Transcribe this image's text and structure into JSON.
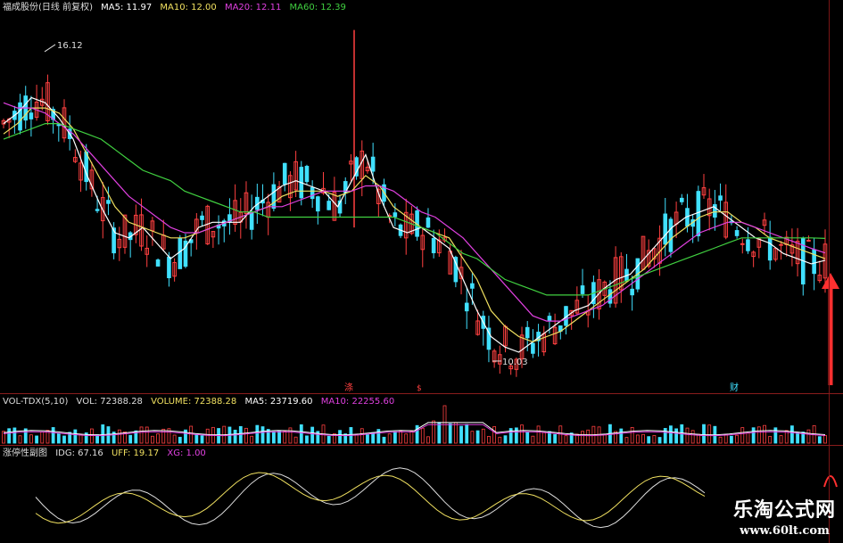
{
  "main_panel": {
    "title": "福成股份(日线 前复权)",
    "ma_labels": [
      {
        "name": "MA5",
        "value": "MA5: 11.97",
        "color": "#ffffff"
      },
      {
        "name": "MA10",
        "value": "MA10: 12.00",
        "color": "#f0e060"
      },
      {
        "name": "MA20",
        "value": "MA20: 12.11",
        "color": "#e040e0"
      },
      {
        "name": "MA60",
        "value": "MA60: 12.39",
        "color": "#40d040"
      }
    ],
    "high_label": "16.12",
    "low_label": "10.03",
    "event_markers": [
      "涤",
      "财"
    ]
  },
  "volume_panel": {
    "title": "VOL-TDX(5,10)",
    "labels": [
      {
        "value": "VOL: 72388.28",
        "color": "#dddddd"
      },
      {
        "value": "VOLUME: 72388.28",
        "color": "#f0e060"
      },
      {
        "value": "MA5: 23719.60",
        "color": "#ffffff"
      },
      {
        "value": "MA10: 22255.60",
        "color": "#e040e0"
      }
    ]
  },
  "indicator_panel": {
    "title": "涨停性副图",
    "labels": [
      {
        "value": "IDG: 67.16",
        "color": "#dddddd"
      },
      {
        "value": "UFF: 19.17",
        "color": "#f0e060"
      },
      {
        "value": "XG: 1.00",
        "color": "#e040e0"
      }
    ]
  },
  "watermark": {
    "title": "乐淘公式网",
    "url": "www.60lt.com"
  },
  "colors": {
    "up": "#ff4040",
    "down": "#40e0ff",
    "ma5": "#ffffff",
    "ma10": "#f0e060",
    "ma20": "#e040e0",
    "ma60": "#40d040",
    "arrow": "#ff3030",
    "grid": "#8a1c1c"
  },
  "chart_data": {
    "type": "line",
    "series": [
      {
        "name": "MA5",
        "values": [
          14.6,
          14.8,
          15.1,
          15.0,
          14.7,
          14.3,
          13.6,
          13.0,
          12.5,
          12.4,
          12.6,
          12.3,
          12.0,
          12.2,
          12.6,
          12.7,
          12.7,
          12.7,
          13.0,
          13.2,
          13.4,
          13.5,
          13.4,
          13.3,
          13.0,
          13.5,
          14.0,
          13.2,
          12.6,
          12.5,
          12.6,
          12.4,
          12.2,
          11.6,
          11.0,
          10.5,
          10.3,
          10.2,
          10.4,
          10.6,
          10.8,
          11.0,
          11.1,
          11.4,
          11.6,
          11.7,
          12.0,
          12.3,
          12.6,
          12.8,
          12.9,
          13.0,
          12.8,
          12.6,
          12.4,
          12.3,
          12.1,
          12.0,
          11.9,
          11.97
        ]
      },
      {
        "name": "MA10",
        "values": [
          14.4,
          14.6,
          14.9,
          14.9,
          14.8,
          14.5,
          14.0,
          13.5,
          13.0,
          12.7,
          12.6,
          12.5,
          12.4,
          12.4,
          12.5,
          12.6,
          12.7,
          12.8,
          12.9,
          13.0,
          13.2,
          13.3,
          13.3,
          13.3,
          13.2,
          13.3,
          13.6,
          13.4,
          13.0,
          12.8,
          12.6,
          12.5,
          12.4,
          12.0,
          11.6,
          11.0,
          10.7,
          10.5,
          10.4,
          10.5,
          10.6,
          10.8,
          11.0,
          11.2,
          11.4,
          11.6,
          11.8,
          12.1,
          12.4,
          12.6,
          12.8,
          12.9,
          12.9,
          12.7,
          12.6,
          12.4,
          12.3,
          12.2,
          12.1,
          12.0
        ]
      },
      {
        "name": "MA20",
        "values": [
          15.0,
          14.9,
          14.9,
          14.8,
          14.6,
          14.4,
          14.1,
          13.8,
          13.5,
          13.2,
          13.0,
          12.8,
          12.6,
          12.5,
          12.5,
          12.6,
          12.7,
          12.8,
          12.9,
          13.0,
          13.0,
          13.1,
          13.2,
          13.3,
          13.3,
          13.3,
          13.4,
          13.4,
          13.3,
          13.1,
          12.9,
          12.8,
          12.6,
          12.4,
          12.1,
          11.8,
          11.5,
          11.2,
          10.9,
          10.8,
          10.8,
          10.9,
          11.0,
          11.1,
          11.3,
          11.5,
          11.7,
          11.9,
          12.1,
          12.3,
          12.5,
          12.6,
          12.7,
          12.7,
          12.6,
          12.5,
          12.4,
          12.3,
          12.2,
          12.11
        ]
      },
      {
        "name": "MA60",
        "values": [
          14.3,
          14.4,
          14.5,
          14.6,
          14.6,
          14.5,
          14.4,
          14.3,
          14.1,
          13.9,
          13.7,
          13.6,
          13.5,
          13.3,
          13.2,
          13.1,
          13.0,
          12.9,
          12.9,
          12.8,
          12.8,
          12.8,
          12.8,
          12.8,
          12.8,
          12.8,
          12.8,
          12.8,
          12.8,
          12.7,
          12.6,
          12.5,
          12.3,
          12.1,
          12.0,
          11.8,
          11.6,
          11.5,
          11.4,
          11.3,
          11.3,
          11.3,
          11.3,
          11.4,
          11.5,
          11.6,
          11.7,
          11.8,
          11.9,
          12.0,
          12.1,
          12.2,
          12.3,
          12.4,
          12.4,
          12.4,
          12.4,
          12.4,
          12.4,
          12.39
        ]
      }
    ],
    "ylim": [
      9.6,
      16.6
    ]
  }
}
